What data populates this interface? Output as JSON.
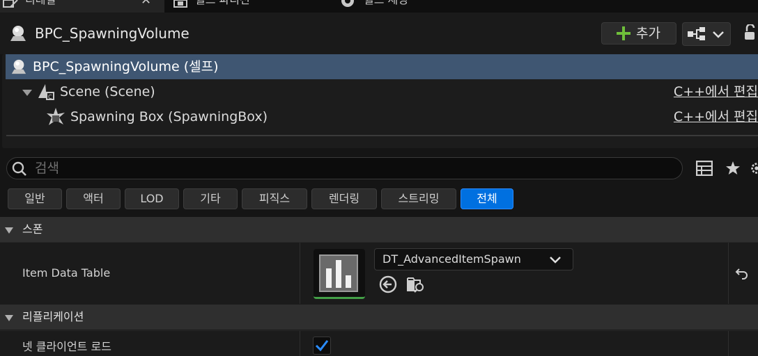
{
  "tabs": [
    {
      "label": "디테일",
      "active": true
    },
    {
      "label": "월드 파티션",
      "active": false
    },
    {
      "label": "월드 세팅",
      "active": false
    }
  ],
  "header": {
    "actor_name": "BPC_SpawningVolume",
    "add_label": "추가"
  },
  "components": [
    {
      "label": "BPC_SpawningVolume (셀프)",
      "edit": "",
      "selected": true
    },
    {
      "label": "Scene (Scene)",
      "edit": "C++에서 편집",
      "selected": false
    },
    {
      "label": "Spawning Box (SpawningBox)",
      "edit": "C++에서 편집",
      "selected": false
    }
  ],
  "search": {
    "placeholder": "검색",
    "value": ""
  },
  "filters": [
    "일반",
    "액터",
    "LOD",
    "기타",
    "피직스",
    "렌더링",
    "스트리밍",
    "전체"
  ],
  "active_filter": "전체",
  "categories": [
    {
      "name": "스폰",
      "properties": [
        {
          "name": "Item Data Table",
          "value": "DT_AdvancedItemSpawn"
        }
      ]
    },
    {
      "name": "리플리케이션",
      "properties": [
        {
          "name": "넷 클라이언트 로드",
          "checked": true
        }
      ]
    }
  ],
  "colors": {
    "selected_row": "#3f5672",
    "active_filter": "#0070e0",
    "add_plus": "#6fbf3a",
    "thumb_underline": "#43a047",
    "check": "#2a8cff"
  },
  "icons": [
    "details-icon",
    "world-partition-icon",
    "world-settings-icon",
    "actor-icon",
    "plus-icon",
    "blueprint-icon",
    "chevron-down-icon",
    "lock-icon",
    "scene-component-icon",
    "spawning-box-icon",
    "search-icon",
    "grid-view-icon",
    "star-icon",
    "gear-icon",
    "data-table-icon",
    "use-selected-icon",
    "browse-asset-icon",
    "reset-arrow-icon",
    "checkmark-icon"
  ]
}
